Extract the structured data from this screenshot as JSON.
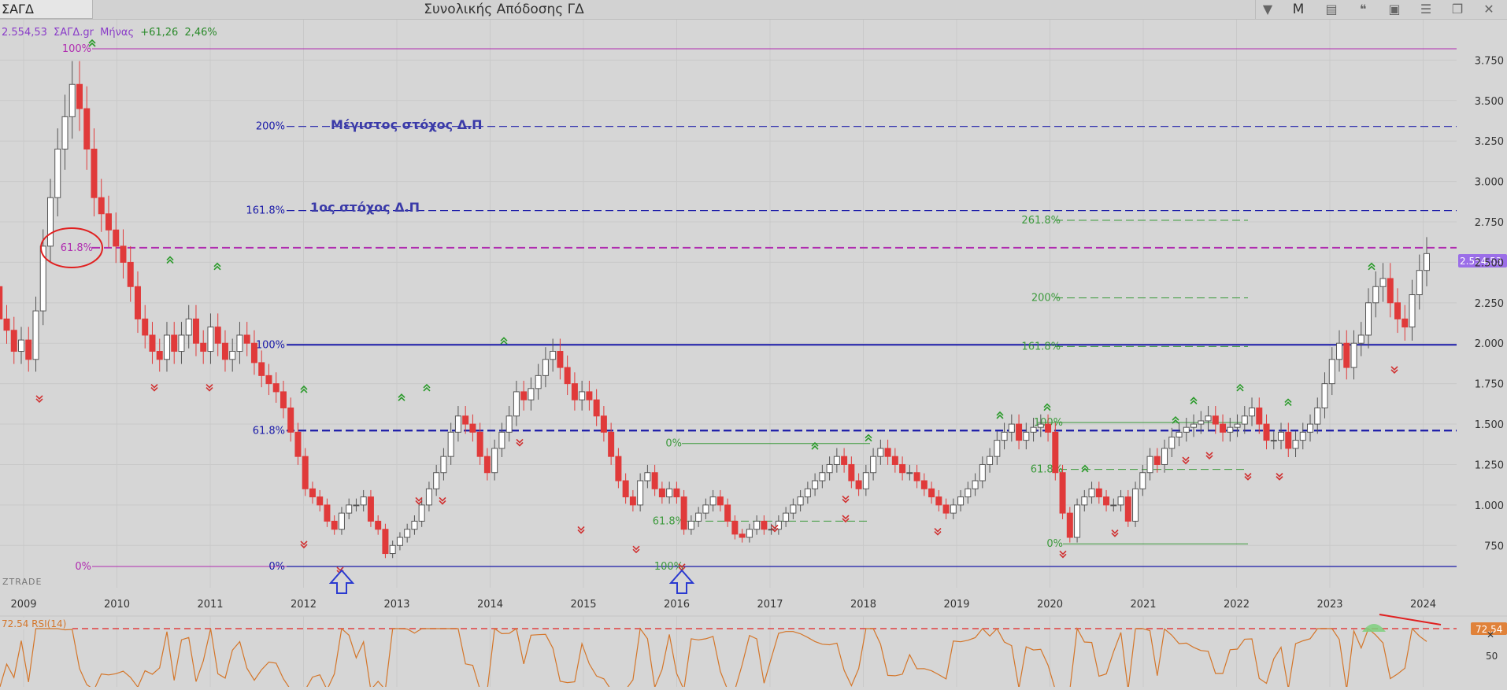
{
  "toolbar": {
    "symbol": "ΣΑΓΔ",
    "title": "Συνολικής Απόδοσης ΓΔ",
    "period_button": "M"
  },
  "quote": {
    "price": "2.554,53",
    "instrument": "ΣΑΓΔ.gr",
    "period": "Μήνας",
    "change": "+61,26",
    "change_pct": "2,46%",
    "price_tag": "2.554,53"
  },
  "watermark": "ZTRADE",
  "colors": {
    "up_candle": "#ffffff",
    "down_candle": "#e03a3a",
    "fib_blue": "#1a1aa8",
    "fib_magenta": "#b02cb0",
    "fib_green": "#3c9a3c",
    "rsi_line": "#d47a2a",
    "price_tag_bg": "#9b6ee8"
  },
  "annotations": {
    "max_target": "Μέγιστος στόχος Δ.Π",
    "first_target": "1ος στόχος Δ.Π"
  },
  "rsi": {
    "label": "72.54 RSI(14)",
    "value_tag": "72.54",
    "level_50": "50"
  },
  "chart_data": {
    "type": "candlestick",
    "period": "monthly",
    "x_axis_years": [
      "2009",
      "2010",
      "2011",
      "2012",
      "2013",
      "2014",
      "2015",
      "2016",
      "2017",
      "2018",
      "2019",
      "2020",
      "2021",
      "2022",
      "2023",
      "2024"
    ],
    "y_ticks": [
      "3.750",
      "3.500",
      "3.250",
      "3.000",
      "2.750",
      "2.500",
      "2.250",
      "2.000",
      "1.750",
      "1.500",
      "1.250",
      "1.000",
      "750"
    ],
    "ylim": [
      620,
      3950
    ],
    "last_price": 2554.53,
    "fib_levels": [
      {
        "label": "100%",
        "value": 3820,
        "color": "magenta",
        "style": "solid"
      },
      {
        "label": "200%",
        "value": 3340,
        "color": "blue",
        "style": "dashed"
      },
      {
        "label": "161.8%",
        "value": 2820,
        "color": "blue",
        "style": "dashed"
      },
      {
        "label": "61.8%",
        "value": 2590,
        "color": "magenta",
        "style": "dashed"
      },
      {
        "label": "100%",
        "value": 1990,
        "color": "blue",
        "style": "solid"
      },
      {
        "label": "61.8%",
        "value": 1460,
        "color": "blue",
        "style": "dashed"
      },
      {
        "label": "0%",
        "value": 620,
        "color": "magenta",
        "style": "solid"
      },
      {
        "label": "0%",
        "value": 620,
        "color": "blue",
        "style": "solid"
      }
    ],
    "green_fib_levels": [
      {
        "label": "261.8%",
        "value": 2760
      },
      {
        "label": "200%",
        "value": 2280
      },
      {
        "label": "161.8%",
        "value": 1980
      },
      {
        "label": "100%",
        "value": 1510
      },
      {
        "label": "61.8%",
        "value": 1220
      },
      {
        "label": "0%",
        "value": 760
      },
      {
        "label": "0%",
        "value": 1380
      },
      {
        "label": "61.8%",
        "value": 900
      },
      {
        "label": "100%",
        "value": 620
      }
    ],
    "close_series": [
      2350,
      2150,
      2080,
      1950,
      2020,
      1900,
      2200,
      2600,
      2900,
      3200,
      3400,
      3600,
      3450,
      3200,
      2900,
      2800,
      2700,
      2600,
      2500,
      2350,
      2150,
      2050,
      1950,
      1900,
      2050,
      1950,
      2050,
      2150,
      2000,
      1950,
      2100,
      2000,
      1900,
      1950,
      2050,
      2000,
      1880,
      1800,
      1750,
      1700,
      1600,
      1450,
      1300,
      1100,
      1050,
      1000,
      900,
      850,
      950,
      1000,
      1000,
      1050,
      900,
      850,
      700,
      750,
      800,
      850,
      900,
      1000,
      1100,
      1200,
      1300,
      1450,
      1550,
      1500,
      1450,
      1300,
      1200,
      1350,
      1450,
      1550,
      1700,
      1650,
      1720,
      1800,
      1900,
      1950,
      1850,
      1750,
      1650,
      1700,
      1650,
      1550,
      1450,
      1300,
      1150,
      1050,
      1000,
      1150,
      1200,
      1100,
      1050,
      1100,
      1050,
      850,
      900,
      950,
      1000,
      1050,
      1000,
      900,
      820,
      800,
      850,
      900,
      850,
      850,
      900,
      950,
      1000,
      1050,
      1100,
      1150,
      1200,
      1250,
      1300,
      1250,
      1150,
      1100,
      1200,
      1300,
      1350,
      1300,
      1250,
      1200,
      1200,
      1150,
      1100,
      1050,
      1000,
      950,
      1000,
      1050,
      1100,
      1150,
      1250,
      1300,
      1400,
      1450,
      1500,
      1400,
      1450,
      1480,
      1500,
      1450,
      1200,
      950,
      800,
      1000,
      1050,
      1100,
      1050,
      1000,
      1000,
      1050,
      900,
      1100,
      1200,
      1300,
      1250,
      1350,
      1420,
      1450,
      1480,
      1500,
      1520,
      1550,
      1500,
      1450,
      1480,
      1500,
      1550,
      1600,
      1500,
      1400,
      1400,
      1450,
      1350,
      1400,
      1450,
      1500,
      1600,
      1750,
      1900,
      2000,
      1850,
      2000,
      2050,
      2250,
      2350,
      2400,
      2250,
      2150,
      2100,
      2300,
      2450,
      2554
    ]
  }
}
